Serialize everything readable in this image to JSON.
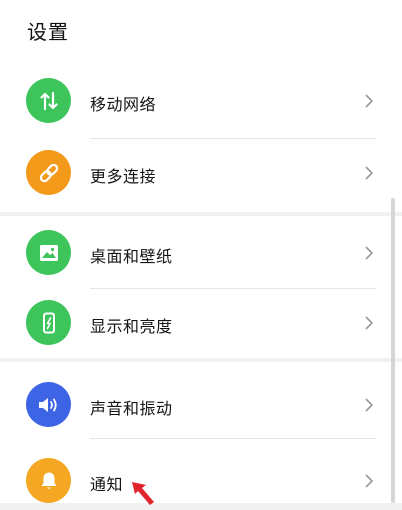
{
  "page": {
    "title": "设置"
  },
  "colors": {
    "green": "#3dc45b",
    "orange": "#f39a1b",
    "blue": "#3e64e6",
    "amber": "#f5a623",
    "pointer": "#e0242c"
  },
  "items": [
    {
      "label": "移动网络",
      "icon": "mobile-data-arrows-icon"
    },
    {
      "label": "更多连接",
      "icon": "link-chain-icon"
    },
    {
      "label": "桌面和壁纸",
      "icon": "picture-icon"
    },
    {
      "label": "显示和亮度",
      "icon": "phone-brightness-icon"
    },
    {
      "label": "声音和振动",
      "icon": "speaker-icon"
    },
    {
      "label": "通知",
      "icon": "bell-icon"
    }
  ]
}
